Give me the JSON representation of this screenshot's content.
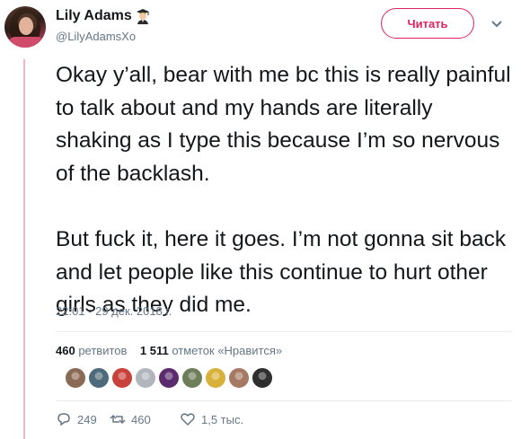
{
  "user": {
    "display_name": "Lily Adams",
    "handle": "@LilyAdamsXo",
    "badge_icon": "graduate-emoji-icon"
  },
  "follow_button": {
    "label": "Читать"
  },
  "tweet": {
    "text": "Okay y’all, bear with me bc this is really painful to talk about and my hands are literally shaking as I type this because I’m so nervous of the backlash.\n\nBut fuck it, here it goes. I’m not gonna sit back and let people like this continue to hurt other girls as they did me.",
    "timestamp": "22:01 - 29 дек. 2018 г."
  },
  "stats": {
    "retweets_count": "460",
    "retweets_label": "ретвитов",
    "likes_count": "1 511",
    "likes_label": "отметок «Нравится»"
  },
  "likers": [
    {
      "name": "liker-avatar-1",
      "color": "#8a6a55"
    },
    {
      "name": "liker-avatar-2",
      "color": "#4d6a7a"
    },
    {
      "name": "liker-avatar-3",
      "color": "#c9413b"
    },
    {
      "name": "liker-avatar-4",
      "color": "#b0b6bb"
    },
    {
      "name": "liker-avatar-5",
      "color": "#5b2b6e"
    },
    {
      "name": "liker-avatar-6",
      "color": "#6e7d5a"
    },
    {
      "name": "liker-avatar-7",
      "color": "#d8b13a"
    },
    {
      "name": "liker-avatar-8",
      "color": "#a67a62"
    },
    {
      "name": "liker-avatar-9",
      "color": "#2f2f2f"
    }
  ],
  "actions": {
    "reply_count": "249",
    "retweet_count": "460",
    "like_count": "1,5 тыс."
  },
  "colors": {
    "accent": "#e0245e",
    "thread_line": "#f5b5c8",
    "muted_text": "#657786"
  }
}
